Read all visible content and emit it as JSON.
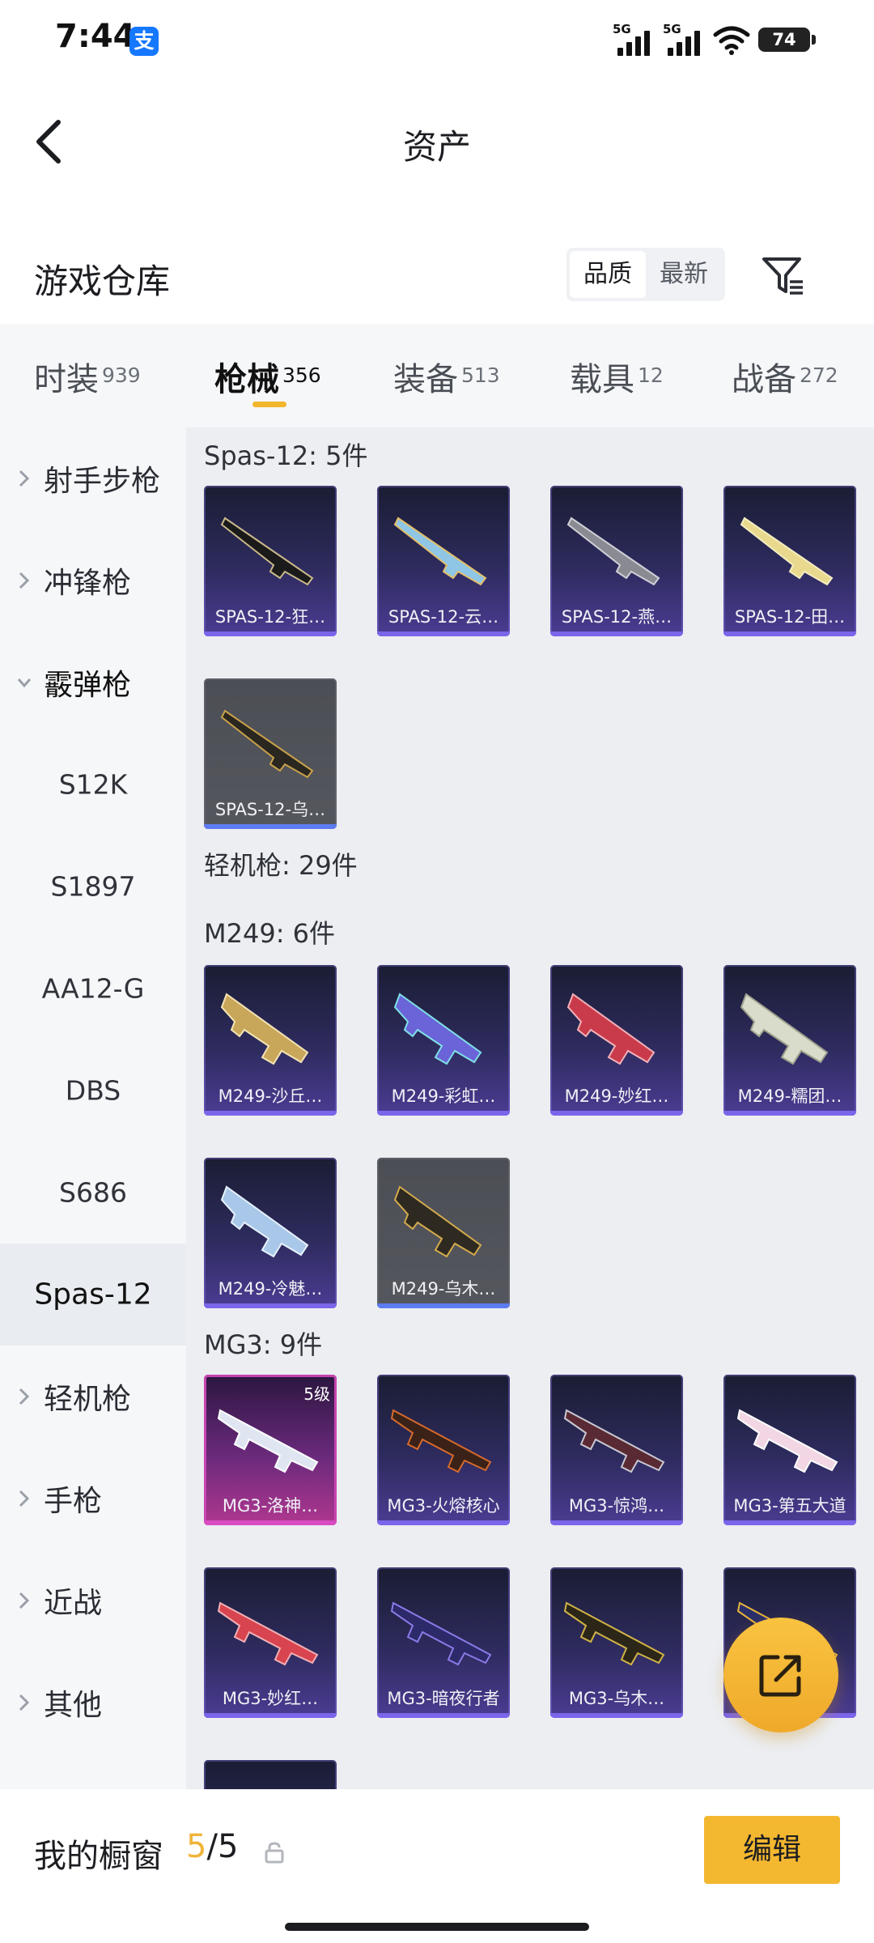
{
  "status_bar": {
    "time": "7:44",
    "app_badge": "支",
    "signal1": "5G",
    "signal2": "5G",
    "battery": "74"
  },
  "header": {
    "title": "资产"
  },
  "warehouse": {
    "title": "游戏仓库",
    "sort_options": [
      "品质",
      "最新"
    ],
    "active_sort": "品质"
  },
  "tabs": [
    {
      "name": "时装",
      "count": "939"
    },
    {
      "name": "枪械",
      "count": "356"
    },
    {
      "name": "装备",
      "count": "513"
    },
    {
      "name": "载具",
      "count": "12"
    },
    {
      "name": "战备",
      "count": "272"
    }
  ],
  "sidebar": {
    "items": [
      {
        "label": "射手步枪"
      },
      {
        "label": "冲锋枪"
      },
      {
        "label": "霰弹枪"
      },
      {
        "label": "S12K"
      },
      {
        "label": "S1897"
      },
      {
        "label": "AA12-G"
      },
      {
        "label": "DBS"
      },
      {
        "label": "S686"
      },
      {
        "label": "Spas-12"
      },
      {
        "label": "轻机枪"
      },
      {
        "label": "手枪"
      },
      {
        "label": "近战"
      },
      {
        "label": "其他"
      }
    ]
  },
  "content": {
    "groups": {
      "spas": "Spas-12: 5件",
      "lmg": "轻机枪: 29件",
      "m249": "M249: 6件",
      "mg3": "MG3: 9件"
    },
    "spas_cards": [
      "SPAS-12-狂…",
      "SPAS-12-云…",
      "SPAS-12-燕…",
      "SPAS-12-田…",
      "SPAS-12-乌…"
    ],
    "m249_cards": [
      "M249-沙丘…",
      "M249-彩虹…",
      "M249-妙红…",
      "M249-糯团…",
      "M249-冷魅…",
      "M249-乌木…"
    ],
    "mg3_cards": [
      "MG3-洛神…",
      "MG3-火熔核心",
      "MG3-惊鸿…",
      "MG3-第五大道",
      "MG3-妙红…",
      "MG3-暗夜行者",
      "MG3-乌木…",
      "…"
    ],
    "mg3_level_badge": "5级"
  },
  "bottom_bar": {
    "showcase_label": "我的橱窗",
    "showcase_current": "5",
    "showcase_separator": "/",
    "showcase_max": "5",
    "edit_label": "编辑"
  },
  "colors": {
    "accent": "#f3b730",
    "card_purple": "#4b3c93",
    "card_grey": "#55575e",
    "card_pink": "#b0378f"
  }
}
